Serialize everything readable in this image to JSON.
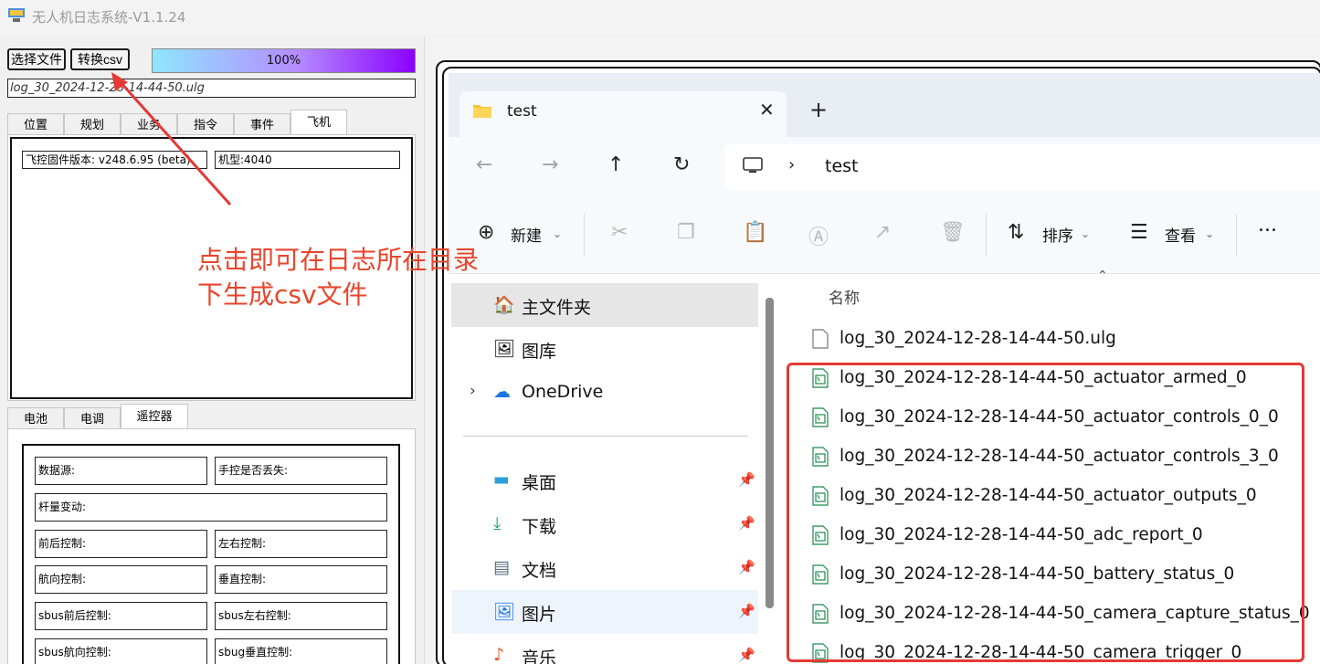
{
  "app": {
    "title": "无人机日志系统-V1.1.24"
  },
  "toolbar": {
    "select_file_label": "选择文件",
    "convert_csv_label": "转换csv",
    "progress_text": "100%",
    "progress_value": 100,
    "file_path": "log_30_2024-12-28-14-44-50.ulg"
  },
  "top_tabs": {
    "items": [
      "位置",
      "规划",
      "业务",
      "指令",
      "事件",
      "飞机"
    ],
    "active": "飞机"
  },
  "aircraft_panel": {
    "firmware": "飞控固件版本: v248.6.95 (beta)",
    "model": "机型:4040"
  },
  "bottom_tabs": {
    "items": [
      "电池",
      "电调",
      "遥控器"
    ],
    "active": "遥控器"
  },
  "rc_panel": {
    "data_source": "数据源:",
    "rc_lost": "手控是否丢失:",
    "stick_change": "杆量变动:",
    "pitch_ctrl": "前后控制:",
    "roll_ctrl": "左右控制:",
    "yaw_ctrl": "航向控制:",
    "throttle_ctrl": "垂直控制:",
    "sbus_pitch": "sbus前后控制:",
    "sbus_roll": "sbus左右控制:",
    "sbus_yaw": "sbus航向控制:",
    "sbug_throttle": "sbug垂直控制:"
  },
  "annotation": {
    "line1": "点击即可在日志所在目录",
    "line2": "下生成csv文件",
    "color": "#e8452c"
  },
  "explorer": {
    "tab_title": "test",
    "new_tab": "+",
    "breadcrumb": "test",
    "toolbar": {
      "new_label": "新建",
      "sort_label": "排序",
      "view_label": "查看",
      "more": "..."
    },
    "nav": {
      "home": "主文件夹",
      "gallery": "图库",
      "onedrive": "OneDrive",
      "desktop": "桌面",
      "downloads": "下载",
      "documents": "文档",
      "pictures": "图片",
      "music": "音乐"
    },
    "column_name": "名称",
    "files": [
      "log_30_2024-12-28-14-44-50.ulg",
      "log_30_2024-12-28-14-44-50_actuator_armed_0",
      "log_30_2024-12-28-14-44-50_actuator_controls_0_0",
      "log_30_2024-12-28-14-44-50_actuator_controls_3_0",
      "log_30_2024-12-28-14-44-50_actuator_outputs_0",
      "log_30_2024-12-28-14-44-50_adc_report_0",
      "log_30_2024-12-28-14-44-50_battery_status_0",
      "log_30_2024-12-28-14-44-50_camera_capture_status_0",
      "log_30_2024-12-28-14-44-50_camera_trigger_0"
    ]
  }
}
